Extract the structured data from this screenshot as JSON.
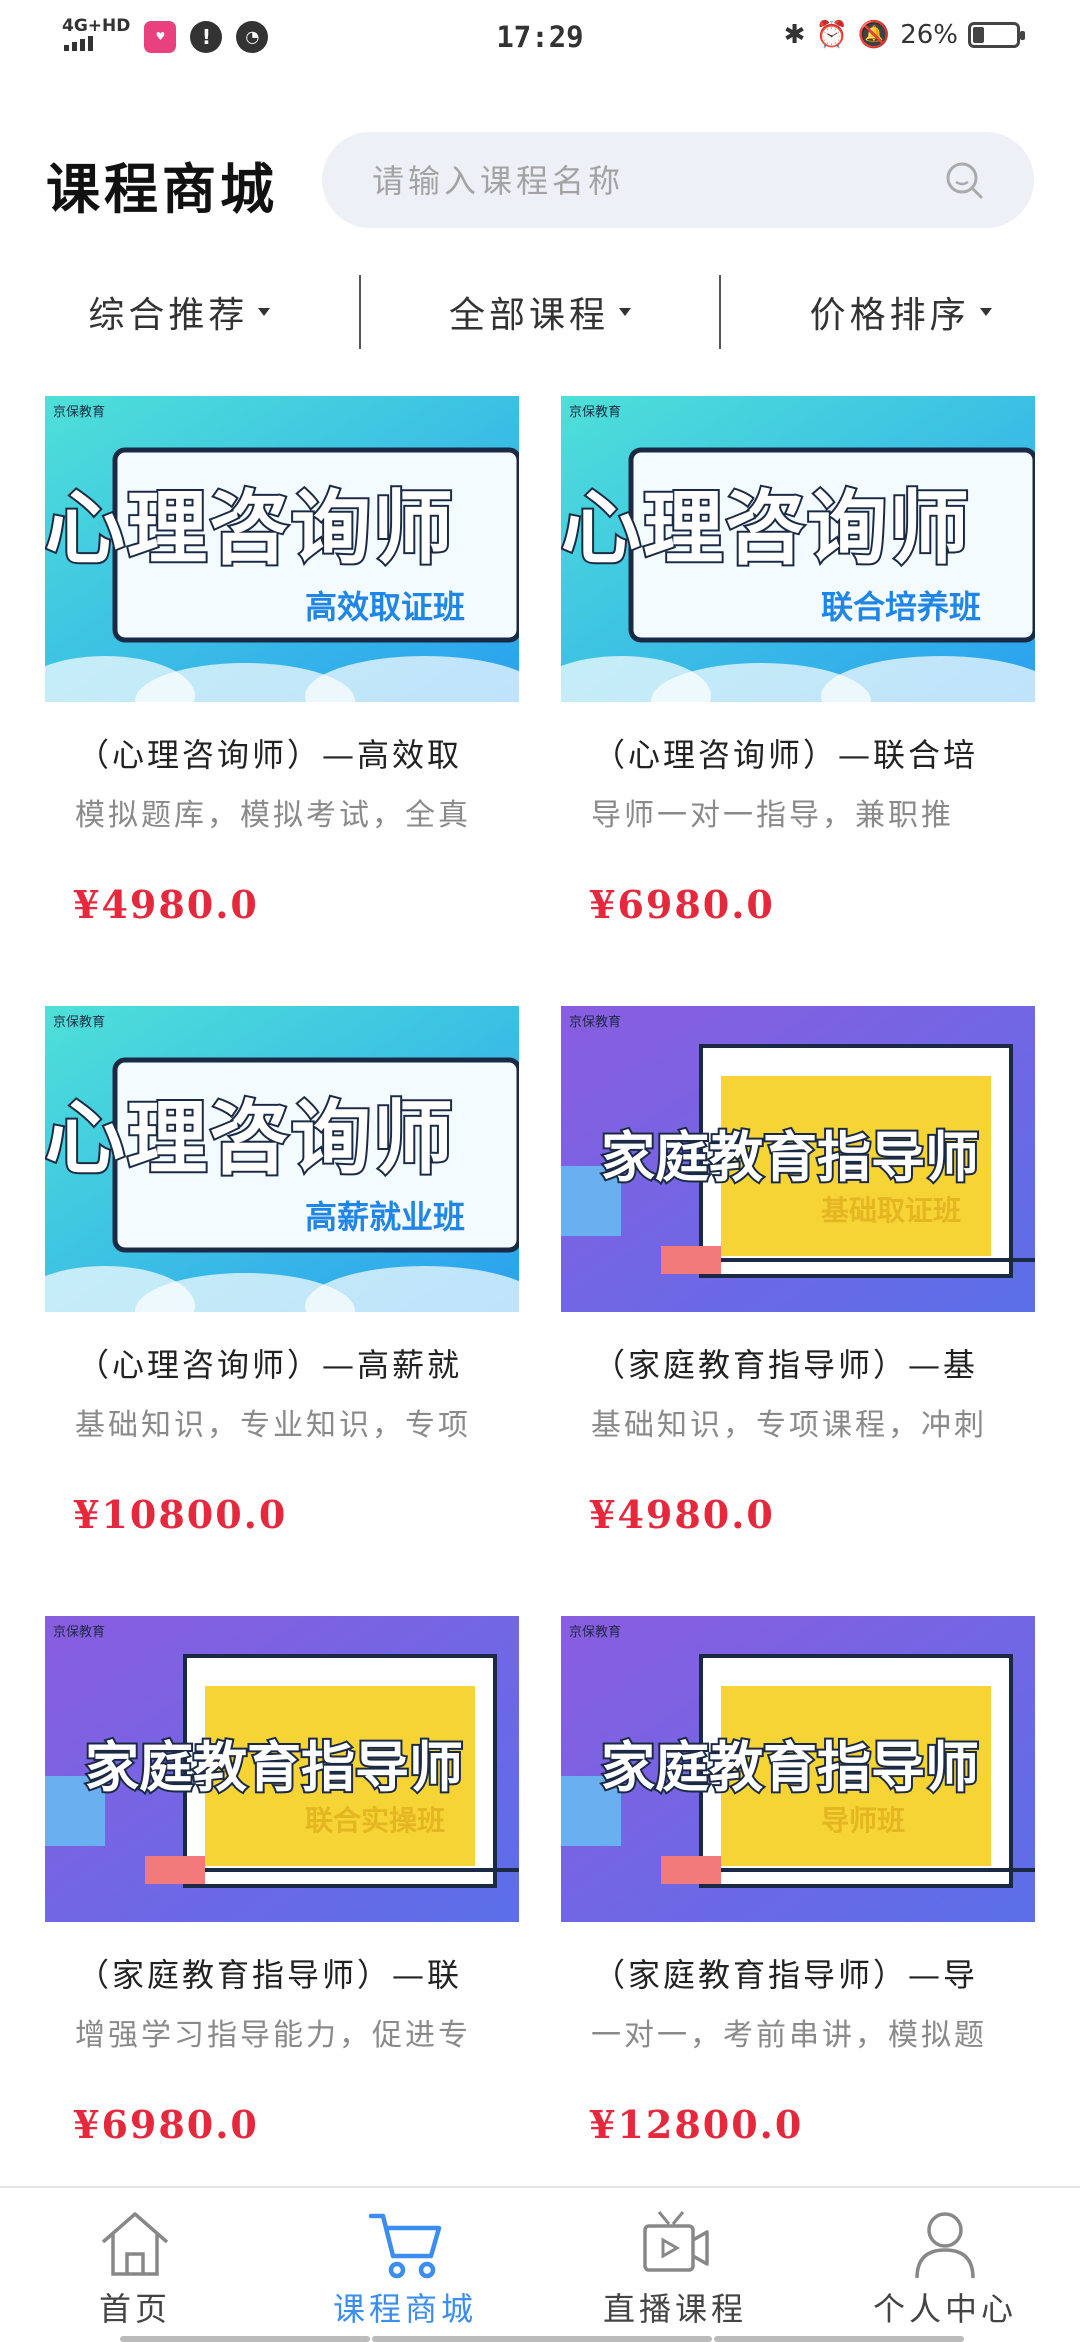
{
  "status_bar": {
    "network": "4G+HD",
    "app_badge": "app",
    "time": "17:29",
    "battery": "26%",
    "battery_level": 0.26
  },
  "header": {
    "title": "课程商城",
    "search_placeholder": "请输入课程名称"
  },
  "filters": [
    {
      "label": "综合推荐"
    },
    {
      "label": "全部课程"
    },
    {
      "label": "价格排序"
    }
  ],
  "courses": [
    {
      "title": "（心理咨询师）—高效取",
      "desc": "模拟题库，模拟考试，全真",
      "price": "¥4980.0",
      "banner_main": "心理咨询师",
      "banner_sub": "高效取证班",
      "theme": "teal"
    },
    {
      "title": "（心理咨询师）—联合培",
      "desc": "导师一对一指导，兼职推",
      "price": "¥6980.0",
      "banner_main": "心理咨询师",
      "banner_sub": "联合培养班",
      "theme": "teal"
    },
    {
      "title": "（心理咨询师）—高薪就",
      "desc": "基础知识，专业知识，专项",
      "price": "¥10800.0",
      "banner_main": "心理咨询师",
      "banner_sub": "高薪就业班",
      "theme": "teal"
    },
    {
      "title": "（家庭教育指导师）—基",
      "desc": "基础知识，专项课程，冲刺",
      "price": "¥4980.0",
      "banner_main": "家庭教育指导师",
      "banner_sub": "基础取证班",
      "theme": "purple"
    },
    {
      "title": "（家庭教育指导师）—联",
      "desc": "增强学习指导能力，促进专",
      "price": "¥6980.0",
      "banner_main": "家庭教育指导师",
      "banner_sub": "联合实操班",
      "theme": "purple"
    },
    {
      "title": "（家庭教育指导师）—导",
      "desc": "一对一，考前串讲，模拟题",
      "price": "¥12800.0",
      "banner_main": "家庭教育指导师",
      "banner_sub": "导师班",
      "theme": "purple"
    }
  ],
  "banner_logo": "京保教育",
  "bottom_nav": [
    {
      "label": "首页",
      "icon": "home-icon",
      "active": false
    },
    {
      "label": "课程商城",
      "icon": "cart-icon",
      "active": true
    },
    {
      "label": "直播课程",
      "icon": "live-video-icon",
      "active": false
    },
    {
      "label": "个人中心",
      "icon": "person-icon",
      "active": false
    }
  ],
  "colors": {
    "accent": "#3b8ef0",
    "price": "#e5283c",
    "search_bg": "#edf0f7"
  }
}
